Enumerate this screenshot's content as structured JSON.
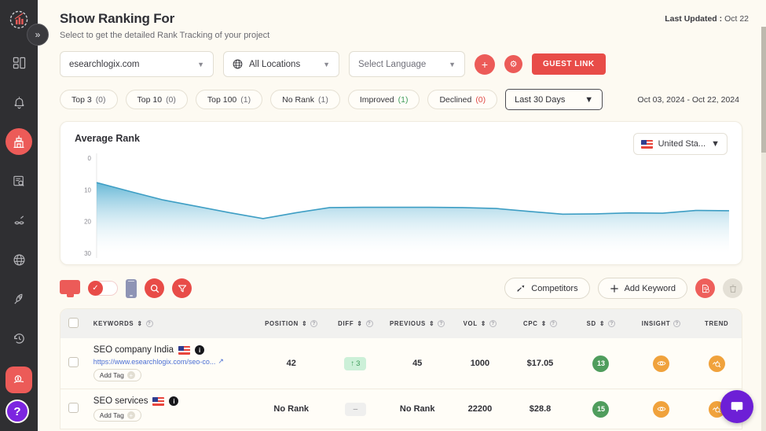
{
  "sidebar": {
    "logo": "logo-icon",
    "collapse": "»",
    "items": [
      {
        "name": "dashboard",
        "icon": "dashboard-icon"
      },
      {
        "name": "notifications",
        "icon": "bell-icon"
      },
      {
        "name": "rank-tracking",
        "icon": "rank-tracking-icon",
        "active": true
      },
      {
        "name": "site-audit",
        "icon": "site-audit-icon"
      },
      {
        "name": "backlinks",
        "icon": "backlinks-icon"
      },
      {
        "name": "global",
        "icon": "globe-icon"
      },
      {
        "name": "tools",
        "icon": "rocket-icon"
      },
      {
        "name": "history",
        "icon": "history-icon"
      }
    ],
    "bottom": [
      {
        "name": "pricing",
        "icon": "money-icon",
        "active": true
      },
      {
        "name": "logout",
        "icon": "logout-icon"
      }
    ],
    "help_label": "?"
  },
  "header": {
    "title": "Show Ranking For",
    "subtitle": "Select to get the detailed Rank Tracking of your project",
    "last_updated_label": "Last Updated :",
    "last_updated_value": "Oct 22"
  },
  "selectors": {
    "domain": "esearchlogix.com",
    "location": "All Locations",
    "language": "Select Language",
    "add_label": "+",
    "settings_label": "⚙",
    "guest_link": "GUEST LINK"
  },
  "filters": {
    "chips": [
      {
        "label": "Top 3",
        "count": "(0)",
        "tone": "gray"
      },
      {
        "label": "Top 10",
        "count": "(0)",
        "tone": "gray"
      },
      {
        "label": "Top 100",
        "count": "(1)",
        "tone": "gray"
      },
      {
        "label": "No Rank",
        "count": "(1)",
        "tone": "gray"
      },
      {
        "label": "Improved",
        "count": "(1)",
        "tone": "green"
      },
      {
        "label": "Declined",
        "count": "(0)",
        "tone": "red"
      }
    ],
    "date_preset": "Last 30 Days",
    "date_range": "Oct 03, 2024 - Oct 22, 2024"
  },
  "chart_card": {
    "title": "Average Rank",
    "country": "United Sta...",
    "flag": "us-flag-icon"
  },
  "chart_data": {
    "type": "area",
    "title": "Average Rank",
    "xlabel": "",
    "ylabel": "",
    "ylim": [
      0,
      30
    ],
    "y_inverted": true,
    "grid": false,
    "legend": "none",
    "tick_labels": [
      "0",
      "10",
      "20",
      "30"
    ],
    "tick_values": [
      0,
      10,
      20,
      30
    ],
    "x": [
      1,
      2,
      3,
      4,
      5,
      6,
      7,
      8,
      9,
      10,
      11,
      12,
      13,
      14,
      15,
      16,
      17,
      18,
      19,
      20
    ],
    "values": [
      7.7,
      10.5,
      13.2,
      15.2,
      17.2,
      19.1,
      17.2,
      15.6,
      15.5,
      15.5,
      15.5,
      15.6,
      15.9,
      16.8,
      17.7,
      17.6,
      17.3,
      17.4,
      16.5,
      16.6
    ],
    "series": [
      {
        "name": "Average Rank",
        "values": [
          7.7,
          10.5,
          13.2,
          15.2,
          17.2,
          19.1,
          17.2,
          15.6,
          15.5,
          15.5,
          15.5,
          15.6,
          15.9,
          16.8,
          17.7,
          17.6,
          17.3,
          17.4,
          16.5,
          16.6
        ]
      }
    ],
    "line_color": "#3e9ec4",
    "fill_top_color": "#5fb4d4",
    "fill_bottom_color": "#ffffff"
  },
  "toolbar": {
    "device_desktop": "monitor-icon",
    "device_toggle_state": "on",
    "device_mobile": "phone-icon",
    "search": "search-icon",
    "filter": "filter-icon",
    "competitors": "Competitors",
    "add_keyword": "Add Keyword",
    "export": "export-icon",
    "delete": "trash-icon"
  },
  "table": {
    "columns": [
      {
        "label": "KEYWORDS",
        "sortable": true,
        "help": true
      },
      {
        "label": "POSITION",
        "sortable": true,
        "help": true
      },
      {
        "label": "DIFF",
        "sortable": true,
        "help": true
      },
      {
        "label": "PREVIOUS",
        "sortable": true,
        "help": true
      },
      {
        "label": "VOL",
        "sortable": true,
        "help": true
      },
      {
        "label": "CPC",
        "sortable": true,
        "help": true
      },
      {
        "label": "SD",
        "sortable": true,
        "help": true
      },
      {
        "label": "INSIGHT",
        "sortable": false,
        "help": true
      },
      {
        "label": "TREND",
        "sortable": false,
        "help": false
      }
    ],
    "rows": [
      {
        "keyword": "SEO company India",
        "flag": "us-flag-icon",
        "url": "https://www.esearchlogix.com/seo-co...",
        "add_tag": "Add Tag",
        "position": "42",
        "diff": "3",
        "diff_dir": "up",
        "previous": "45",
        "vol": "1000",
        "cpc": "$17.05",
        "sd": "13",
        "insight": "insight-icon",
        "trend": "trend-icon"
      },
      {
        "keyword": "SEO services",
        "flag": "us-flag-icon",
        "url": "",
        "add_tag": "Add Tag",
        "position": "No Rank",
        "diff": "–",
        "diff_dir": "none",
        "previous": "No Rank",
        "vol": "22200",
        "cpc": "$28.8",
        "sd": "15",
        "insight": "insight-icon",
        "trend": "trend-icon"
      }
    ]
  },
  "chat": {
    "icon": "chat-icon"
  },
  "colors": {
    "brand_red": "#e84c48",
    "sidebar_bg": "#2f2f32",
    "page_bg": "#fdfaf2",
    "chart_blue": "#3e9ec4",
    "green": "#4f9d5d",
    "orange": "#f0a23c",
    "chat_purple": "#6d1fd6"
  }
}
